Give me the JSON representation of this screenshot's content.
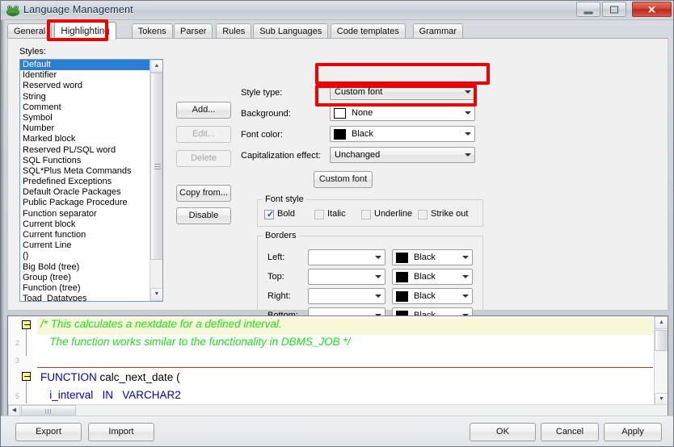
{
  "window": {
    "title": "Language Management",
    "icon": "toad-frog-icon",
    "controls": {
      "minimize": "minimize-icon",
      "maximize": "restore-icon",
      "close": "✕"
    }
  },
  "tabs": [
    {
      "label": "General",
      "active": false
    },
    {
      "label": "Highlighting",
      "active": true
    },
    {
      "label": "Tokens",
      "active": false
    },
    {
      "label": "Parser",
      "active": false
    },
    {
      "label": "Rules",
      "active": false
    },
    {
      "label": "Sub Languages",
      "active": false
    },
    {
      "label": "Code templates",
      "active": false
    },
    {
      "label": "Grammar",
      "active": false
    }
  ],
  "styles_panel": {
    "label": "Styles:",
    "selected": "Default",
    "items": [
      "Default",
      "Identifier",
      "Reserved word",
      "String",
      "Comment",
      "Symbol",
      "Number",
      "Marked block",
      "Reserved PL/SQL word",
      "SQL Functions",
      "SQL*Plus Meta Commands",
      "Predefined Exceptions",
      "Default Oracle Packages",
      "Public Package Procedure",
      "Function separator",
      "Current block",
      "Current function",
      "Current Line",
      "()",
      "Big Bold (tree)",
      "Group (tree)",
      "Function (tree)",
      "Toad_Datatypes"
    ]
  },
  "style_buttons": [
    {
      "label": "Add...",
      "enabled": true
    },
    {
      "label": "Edit...",
      "enabled": false
    },
    {
      "label": "Delete",
      "enabled": false
    },
    {
      "label": "Copy from...",
      "enabled": true
    },
    {
      "label": "Disable",
      "enabled": true
    }
  ],
  "form": {
    "style_type": {
      "label": "Style type:",
      "value": "Custom font"
    },
    "background": {
      "label": "Background:",
      "value": "None",
      "swatch": "#ffffff"
    },
    "font_color": {
      "label": "Font color:",
      "value": "Black",
      "swatch": "#000000"
    },
    "capitalization": {
      "label": "Capitalization effect:",
      "value": "Unchanged"
    },
    "custom_font_button": "Custom font"
  },
  "font_style": {
    "title": "Font style",
    "options": [
      {
        "label": "Bold",
        "checked": true
      },
      {
        "label": "Italic",
        "checked": false
      },
      {
        "label": "Underline",
        "checked": false
      },
      {
        "label": "Strike out",
        "checked": false
      }
    ]
  },
  "borders": {
    "title": "Borders",
    "rows": [
      {
        "label": "Left:",
        "style": "",
        "color": "Black",
        "swatch": "#000000"
      },
      {
        "label": "Top:",
        "style": "",
        "color": "Black",
        "swatch": "#000000"
      },
      {
        "label": "Right:",
        "style": "",
        "color": "Black",
        "swatch": "#000000"
      },
      {
        "label": "Bottom:",
        "style": "",
        "color": "Black",
        "swatch": "#000000"
      }
    ]
  },
  "code_preview": {
    "line1": "/* This calculates a nextdate for a defined interval.",
    "line2": "   The function works similar to the functionality in DBMS_JOB */",
    "line4_kw": "FUNCTION",
    "line4_rest": " calc_next_date (",
    "line5": "   i_interval   IN   VARCHAR2",
    "gutter_numbers": [
      "2",
      "3",
      "5"
    ],
    "comment_color": "#1fe01f",
    "keyword_color": "#0000c8",
    "highlight_color": "#f8f8d8",
    "current_line_rule_color": "#b03a2e"
  },
  "bottom_buttons": [
    {
      "label": "Export"
    },
    {
      "label": "Import"
    },
    {
      "label": "OK"
    },
    {
      "label": "Cancel"
    },
    {
      "label": "Apply"
    }
  ],
  "annotations": {
    "accent_color": "#ee0000",
    "boxes": [
      "highlighting-tab",
      "background-combo",
      "font-color-combo"
    ]
  }
}
